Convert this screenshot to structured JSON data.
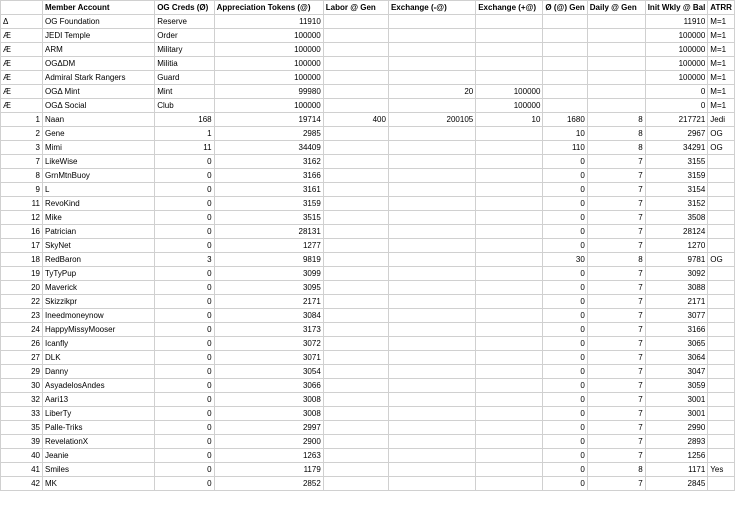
{
  "headers": [
    "",
    "Member Account",
    "OG Creds (Ø)",
    "Appreciation Tokens (@)",
    "Labor @ Gen",
    "Exchange (-@)",
    "Exchange (+@)",
    "Ø (@) Gen",
    "Daily @ Gen",
    "Init Wkly @ Bal",
    "ATRR"
  ],
  "rows": [
    [
      "Δ",
      "OG Foundation",
      "Reserve",
      "11910",
      "",
      "",
      "",
      "",
      "",
      "11910",
      "M=1"
    ],
    [
      "Æ",
      "JEDI Temple",
      "Order",
      "100000",
      "",
      "",
      "",
      "",
      "",
      "100000",
      "M=1"
    ],
    [
      "Æ",
      "ARM",
      "Military",
      "100000",
      "",
      "",
      "",
      "",
      "",
      "100000",
      "M=1"
    ],
    [
      "Æ",
      "OGΔDM",
      "Militia",
      "100000",
      "",
      "",
      "",
      "",
      "",
      "100000",
      "M=1"
    ],
    [
      "Æ",
      "Admiral Stark Rangers",
      "Guard",
      "100000",
      "",
      "",
      "",
      "",
      "",
      "100000",
      "M=1"
    ],
    [
      "Æ",
      "OGΔ Mint",
      "Mint",
      "99980",
      "",
      "20",
      "100000",
      "",
      "",
      "0",
      "M=1"
    ],
    [
      "Æ",
      "OGΔ Social",
      "Club",
      "100000",
      "",
      "",
      "100000",
      "",
      "",
      "0",
      "M=1"
    ],
    [
      "1",
      "Naan",
      "168",
      "19714",
      "400",
      "200105",
      "10",
      "1680",
      "8",
      "217721",
      "Jedi"
    ],
    [
      "2",
      "Gene",
      "1",
      "2985",
      "",
      "",
      "",
      "10",
      "8",
      "2967",
      "OG"
    ],
    [
      "3",
      "Mimi",
      "11",
      "34409",
      "",
      "",
      "",
      "110",
      "8",
      "34291",
      "OG"
    ],
    [
      "7",
      "LikeWise",
      "0",
      "3162",
      "",
      "",
      "",
      "0",
      "7",
      "3155",
      ""
    ],
    [
      "8",
      "GrnMtnBuoy",
      "0",
      "3166",
      "",
      "",
      "",
      "0",
      "7",
      "3159",
      ""
    ],
    [
      "9",
      "L",
      "0",
      "3161",
      "",
      "",
      "",
      "0",
      "7",
      "3154",
      ""
    ],
    [
      "11",
      "RevoKind",
      "0",
      "3159",
      "",
      "",
      "",
      "0",
      "7",
      "3152",
      ""
    ],
    [
      "12",
      "Mike",
      "0",
      "3515",
      "",
      "",
      "",
      "0",
      "7",
      "3508",
      ""
    ],
    [
      "16",
      "Patrician",
      "0",
      "28131",
      "",
      "",
      "",
      "0",
      "7",
      "28124",
      ""
    ],
    [
      "17",
      "SkyNet",
      "0",
      "1277",
      "",
      "",
      "",
      "0",
      "7",
      "1270",
      ""
    ],
    [
      "18",
      "RedBaron",
      "3",
      "9819",
      "",
      "",
      "",
      "30",
      "8",
      "9781",
      "OG"
    ],
    [
      "19",
      "TyTyPup",
      "0",
      "3099",
      "",
      "",
      "",
      "0",
      "7",
      "3092",
      ""
    ],
    [
      "20",
      "Maverick",
      "0",
      "3095",
      "",
      "",
      "",
      "0",
      "7",
      "3088",
      ""
    ],
    [
      "22",
      "Skizzikpr",
      "0",
      "2171",
      "",
      "",
      "",
      "0",
      "7",
      "2171",
      ""
    ],
    [
      "23",
      "Ineedmoneynow",
      "0",
      "3084",
      "",
      "",
      "",
      "0",
      "7",
      "3077",
      ""
    ],
    [
      "24",
      "HappyMissyMooser",
      "0",
      "3173",
      "",
      "",
      "",
      "0",
      "7",
      "3166",
      ""
    ],
    [
      "26",
      "Icanfly",
      "0",
      "3072",
      "",
      "",
      "",
      "0",
      "7",
      "3065",
      ""
    ],
    [
      "27",
      "DLK",
      "0",
      "3071",
      "",
      "",
      "",
      "0",
      "7",
      "3064",
      ""
    ],
    [
      "29",
      "Danny",
      "0",
      "3054",
      "",
      "",
      "",
      "0",
      "7",
      "3047",
      ""
    ],
    [
      "30",
      "AsyadelosAndes",
      "0",
      "3066",
      "",
      "",
      "",
      "0",
      "7",
      "3059",
      ""
    ],
    [
      "32",
      "Aari13",
      "0",
      "3008",
      "",
      "",
      "",
      "0",
      "7",
      "3001",
      ""
    ],
    [
      "33",
      "LiberTy",
      "0",
      "3008",
      "",
      "",
      "",
      "0",
      "7",
      "3001",
      ""
    ],
    [
      "35",
      "Palle-Triks",
      "0",
      "2997",
      "",
      "",
      "",
      "0",
      "7",
      "2990",
      ""
    ],
    [
      "39",
      "RevelationX",
      "0",
      "2900",
      "",
      "",
      "",
      "0",
      "7",
      "2893",
      ""
    ],
    [
      "40",
      "Jeanie",
      "0",
      "1263",
      "",
      "",
      "",
      "0",
      "7",
      "1256",
      ""
    ],
    [
      "41",
      "Smiles",
      "0",
      "1179",
      "",
      "",
      "",
      "0",
      "8",
      "1171",
      "Yes"
    ],
    [
      "42",
      "MK",
      "0",
      "2852",
      "",
      "",
      "",
      "0",
      "7",
      "2845",
      ""
    ]
  ]
}
